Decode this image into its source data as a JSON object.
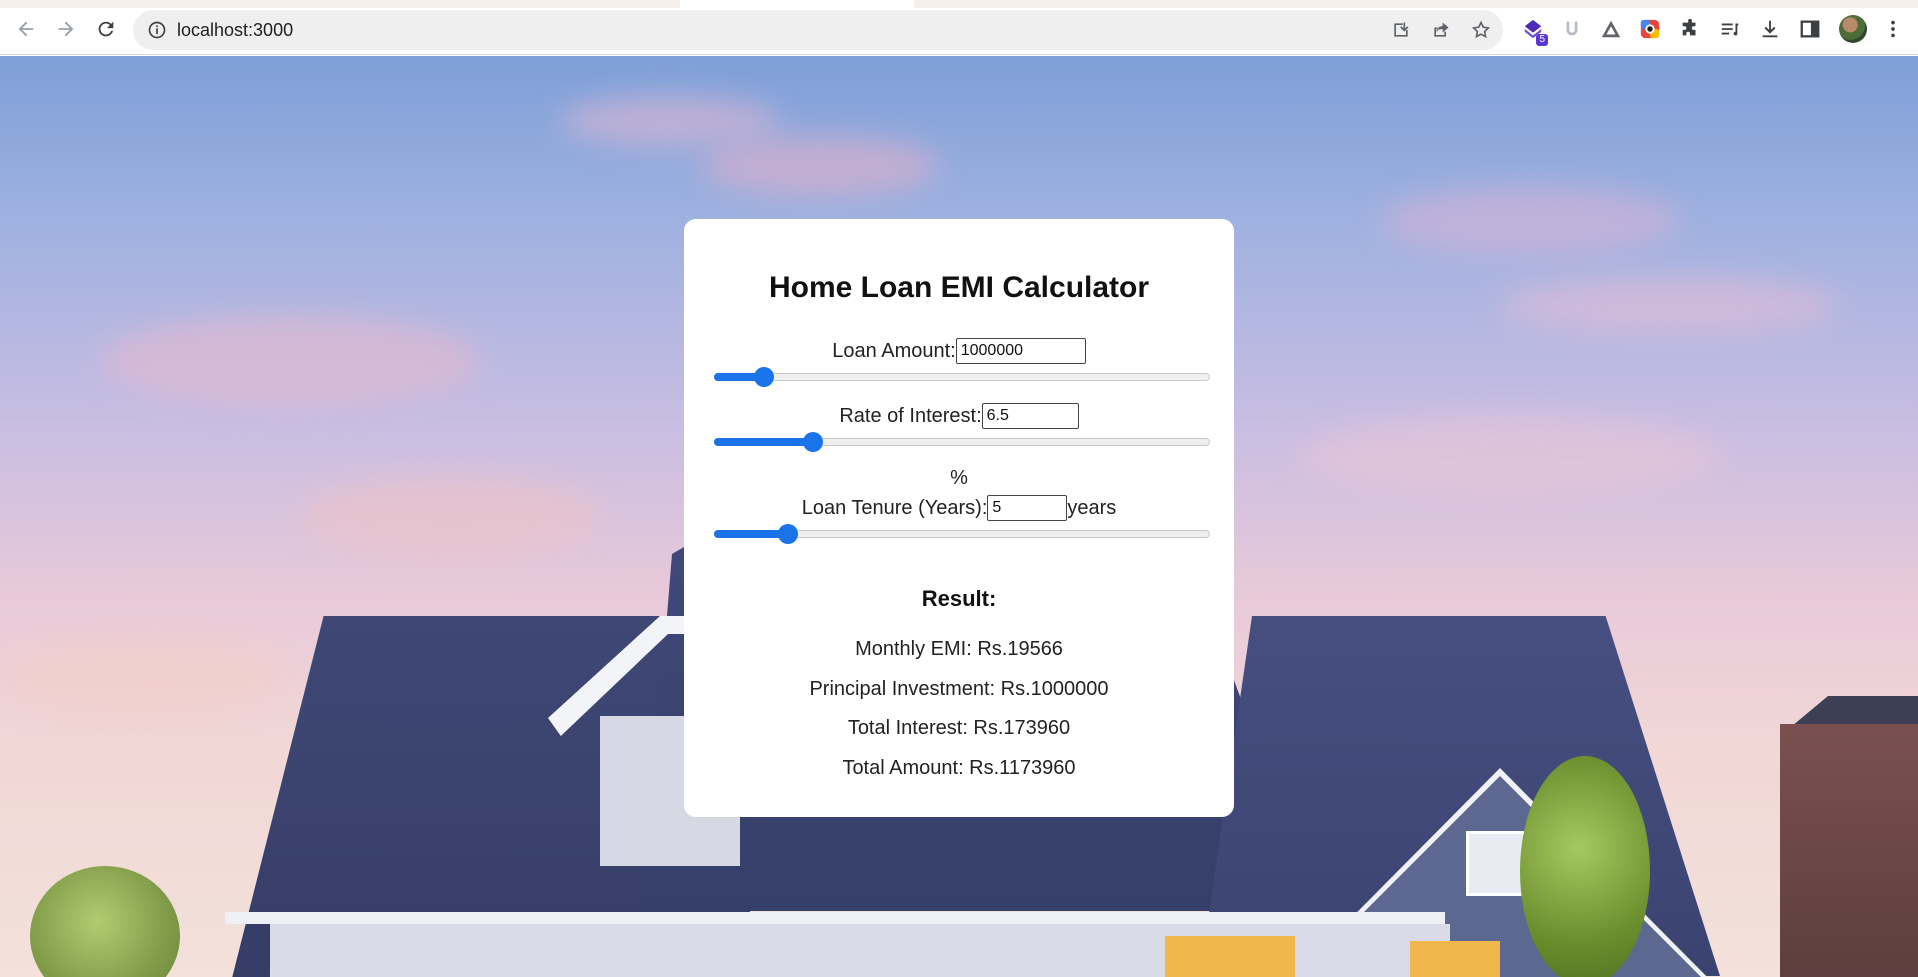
{
  "browser": {
    "url": "localhost:3000",
    "extension_badge": "5"
  },
  "calculator": {
    "title": "Home Loan EMI Calculator",
    "loan_amount": {
      "label": "Loan Amount:",
      "value": "1000000",
      "slider_fraction": 0.1
    },
    "rate_of_interest": {
      "label": "Rate of Interest:",
      "value": "6.5",
      "unit": "%",
      "slider_fraction": 0.2
    },
    "loan_tenure": {
      "label": "Loan Tenure (Years):",
      "value": "5",
      "unit": "years",
      "slider_fraction": 0.15
    },
    "result": {
      "title": "Result:",
      "monthly_emi": "Monthly EMI: Rs.19566",
      "principal": "Principal Investment: Rs.1000000",
      "total_interest": "Total Interest: Rs.173960",
      "total_amount": "Total Amount: Rs.1173960"
    }
  },
  "colors": {
    "accent": "#1a73e8",
    "card_bg": "#ffffff"
  },
  "icons": {
    "back": "arrow-left-icon",
    "forward": "arrow-right-icon",
    "reload": "reload-icon",
    "site_info": "info-icon",
    "install": "install-icon",
    "share": "share-icon",
    "bookmark": "star-icon",
    "extensions": "puzzle-icon",
    "reading_list": "reading-list-icon",
    "downloads": "download-icon",
    "side_panel": "side-panel-icon",
    "menu": "kebab-menu-icon"
  }
}
